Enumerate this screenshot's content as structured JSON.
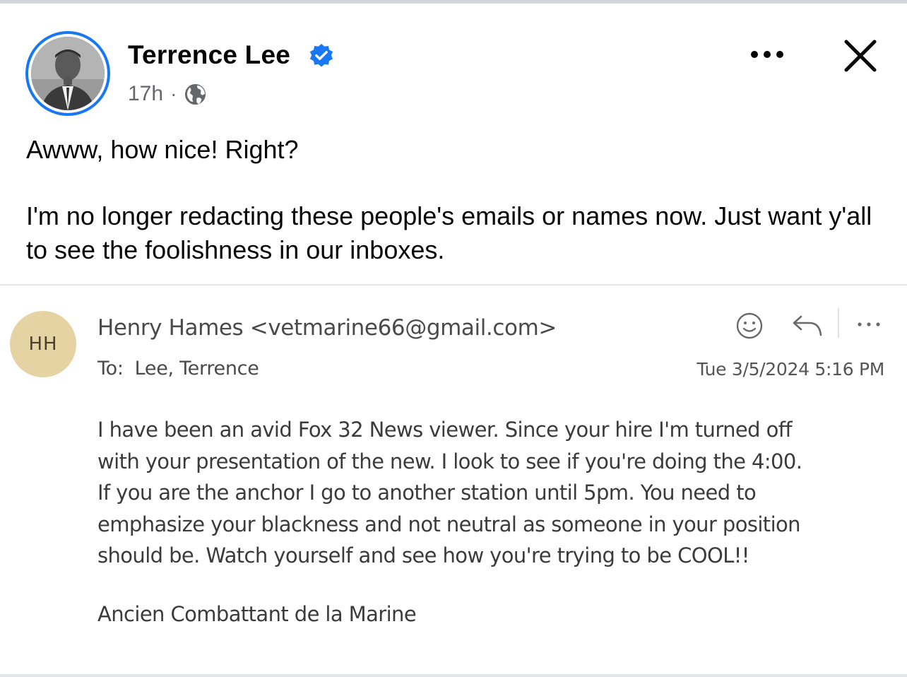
{
  "post": {
    "author_name": "Terrence Lee",
    "verified": true,
    "timestamp": "17h",
    "separator": "·",
    "audience_icon": "globe-icon",
    "text_line1": "Awww, how nice! Right?",
    "text_para2": "I'm no longer redacting these people's emails or names now. Just want y'all to see the foolishness in our inboxes."
  },
  "header_actions": {
    "more_icon": "more-horizontal-icon",
    "close_icon": "close-icon"
  },
  "email": {
    "avatar_initials": "HH",
    "sender": "Henry Hames <vetmarine66@gmail.com>",
    "to_label": "To:",
    "to_value": "Lee, Terrence",
    "date": "Tue 3/5/2024 5:16 PM",
    "body_lines": [
      "I have been an avid Fox 32 News viewer. Since your hire I'm turned off",
      "with your presentation of the new. I look to see if you're doing the 4:00.",
      "If you are the anchor I go to another station until 5pm. You need to",
      "emphasize your blackness and not neutral as someone in your position",
      "should be. Watch yourself and see how you're trying to be COOL!!"
    ],
    "signature": "Ancien Combattant de la Marine",
    "icons": [
      "smiley-icon",
      "reply-icon",
      "more-horizontal-icon"
    ]
  },
  "colors": {
    "accent_blue": "#1877f2",
    "meta_gray": "#65676b",
    "email_avatar_bg": "#e6d3a4"
  }
}
